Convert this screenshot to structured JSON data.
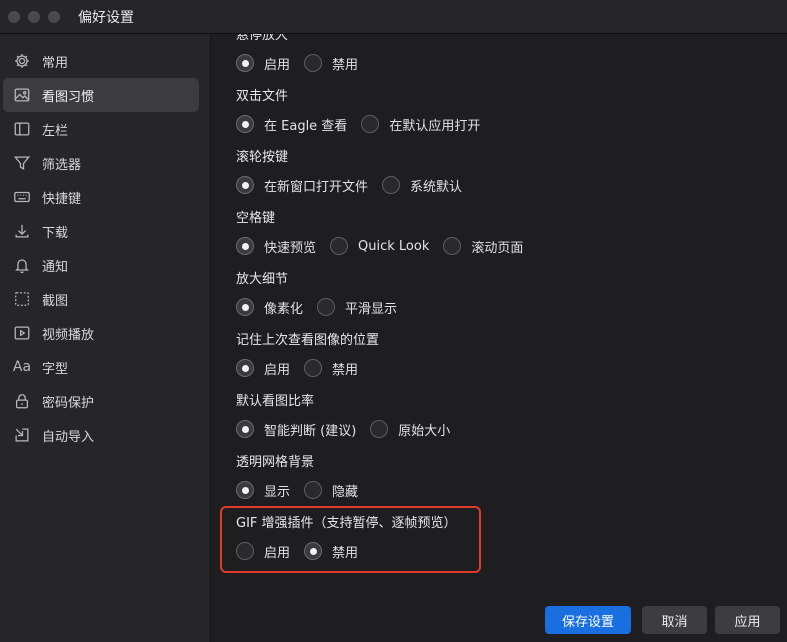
{
  "window": {
    "title": "偏好设置"
  },
  "sidebar": {
    "items": [
      {
        "label": "常用",
        "icon": "gear-icon"
      },
      {
        "label": "看图习惯",
        "icon": "image-icon",
        "active": true
      },
      {
        "label": "左栏",
        "icon": "sidebar-layout-icon"
      },
      {
        "label": "筛选器",
        "icon": "filter-icon"
      },
      {
        "label": "快捷键",
        "icon": "keyboard-icon"
      },
      {
        "label": "下载",
        "icon": "download-icon"
      },
      {
        "label": "通知",
        "icon": "bell-icon"
      },
      {
        "label": "截图",
        "icon": "screenshot-icon"
      },
      {
        "label": "视频播放",
        "icon": "play-icon"
      },
      {
        "label": "字型",
        "icon": "font-icon",
        "glyph": "Aa"
      },
      {
        "label": "密码保护",
        "icon": "lock-icon"
      },
      {
        "label": "自动导入",
        "icon": "import-icon"
      }
    ]
  },
  "settings": [
    {
      "title": "悬停放大",
      "options": [
        "启用",
        "禁用"
      ],
      "selected": 0
    },
    {
      "title": "双击文件",
      "options": [
        "在 Eagle 查看",
        "在默认应用打开"
      ],
      "selected": 0
    },
    {
      "title": "滚轮按键",
      "options": [
        "在新窗口打开文件",
        "系统默认"
      ],
      "selected": 0
    },
    {
      "title": "空格键",
      "options": [
        "快速预览",
        "Quick Look",
        "滚动页面"
      ],
      "selected": 0
    },
    {
      "title": "放大细节",
      "options": [
        "像素化",
        "平滑显示"
      ],
      "selected": 0
    },
    {
      "title": "记住上次查看图像的位置",
      "options": [
        "启用",
        "禁用"
      ],
      "selected": 0
    },
    {
      "title": "默认看图比率",
      "options": [
        "智能判断 (建议)",
        "原始大小"
      ],
      "selected": 0
    },
    {
      "title": "透明网格背景",
      "options": [
        "显示",
        "隐藏"
      ],
      "selected": 0
    },
    {
      "title": "GIF 增强插件（支持暂停、逐帧预览）",
      "options": [
        "启用",
        "禁用"
      ],
      "selected": 1,
      "highlighted": true
    }
  ],
  "buttons": {
    "save": "保存设置",
    "cancel": "取消",
    "apply": "应用"
  },
  "colors": {
    "accent": "#1a6fe0",
    "highlight_border": "#e23a2a",
    "sidebar_bg": "#262629",
    "main_bg": "#1e1e21"
  }
}
